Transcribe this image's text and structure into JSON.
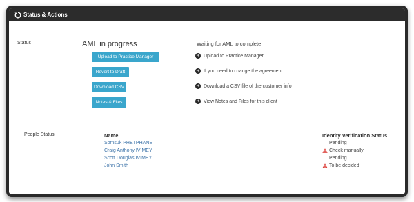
{
  "panel": {
    "title": "Status & Actions"
  },
  "status_section": {
    "label": "Status",
    "aml_title": "AML in progress",
    "buttons": [
      "Upload to Practice Manager",
      "Revert to Draft",
      "Download CSV",
      "Notes & Files"
    ],
    "waiting_text": "Waiting for AML to complete",
    "actions": [
      "Upload to Practice Manager",
      "If you need to change the agreement",
      "Download a CSV file of the customer info",
      "View Notes and Files for this client"
    ]
  },
  "people_section": {
    "label": "People Status",
    "name_header": "Name",
    "status_header": "Identity Verification Status",
    "people": [
      {
        "name": "Somsuk PHETPHANE",
        "status": "Pending",
        "warning": false
      },
      {
        "name": "Craig Anthony IVIMEY",
        "status": "Check manually",
        "warning": true
      },
      {
        "name": "Scott Douglas IVIMEY",
        "status": "Pending",
        "warning": false
      },
      {
        "name": "John Smith",
        "status": "To be decided",
        "warning": true
      }
    ]
  },
  "colors": {
    "header_bg": "#2c2c2c",
    "button_bg": "#3aa6cc",
    "link": "#3b72a8",
    "warning": "#d9312b"
  },
  "icons": {
    "header": "status-actions-icon",
    "action": "arrow-circle-right-icon",
    "warning": "warning-triangle-icon"
  }
}
